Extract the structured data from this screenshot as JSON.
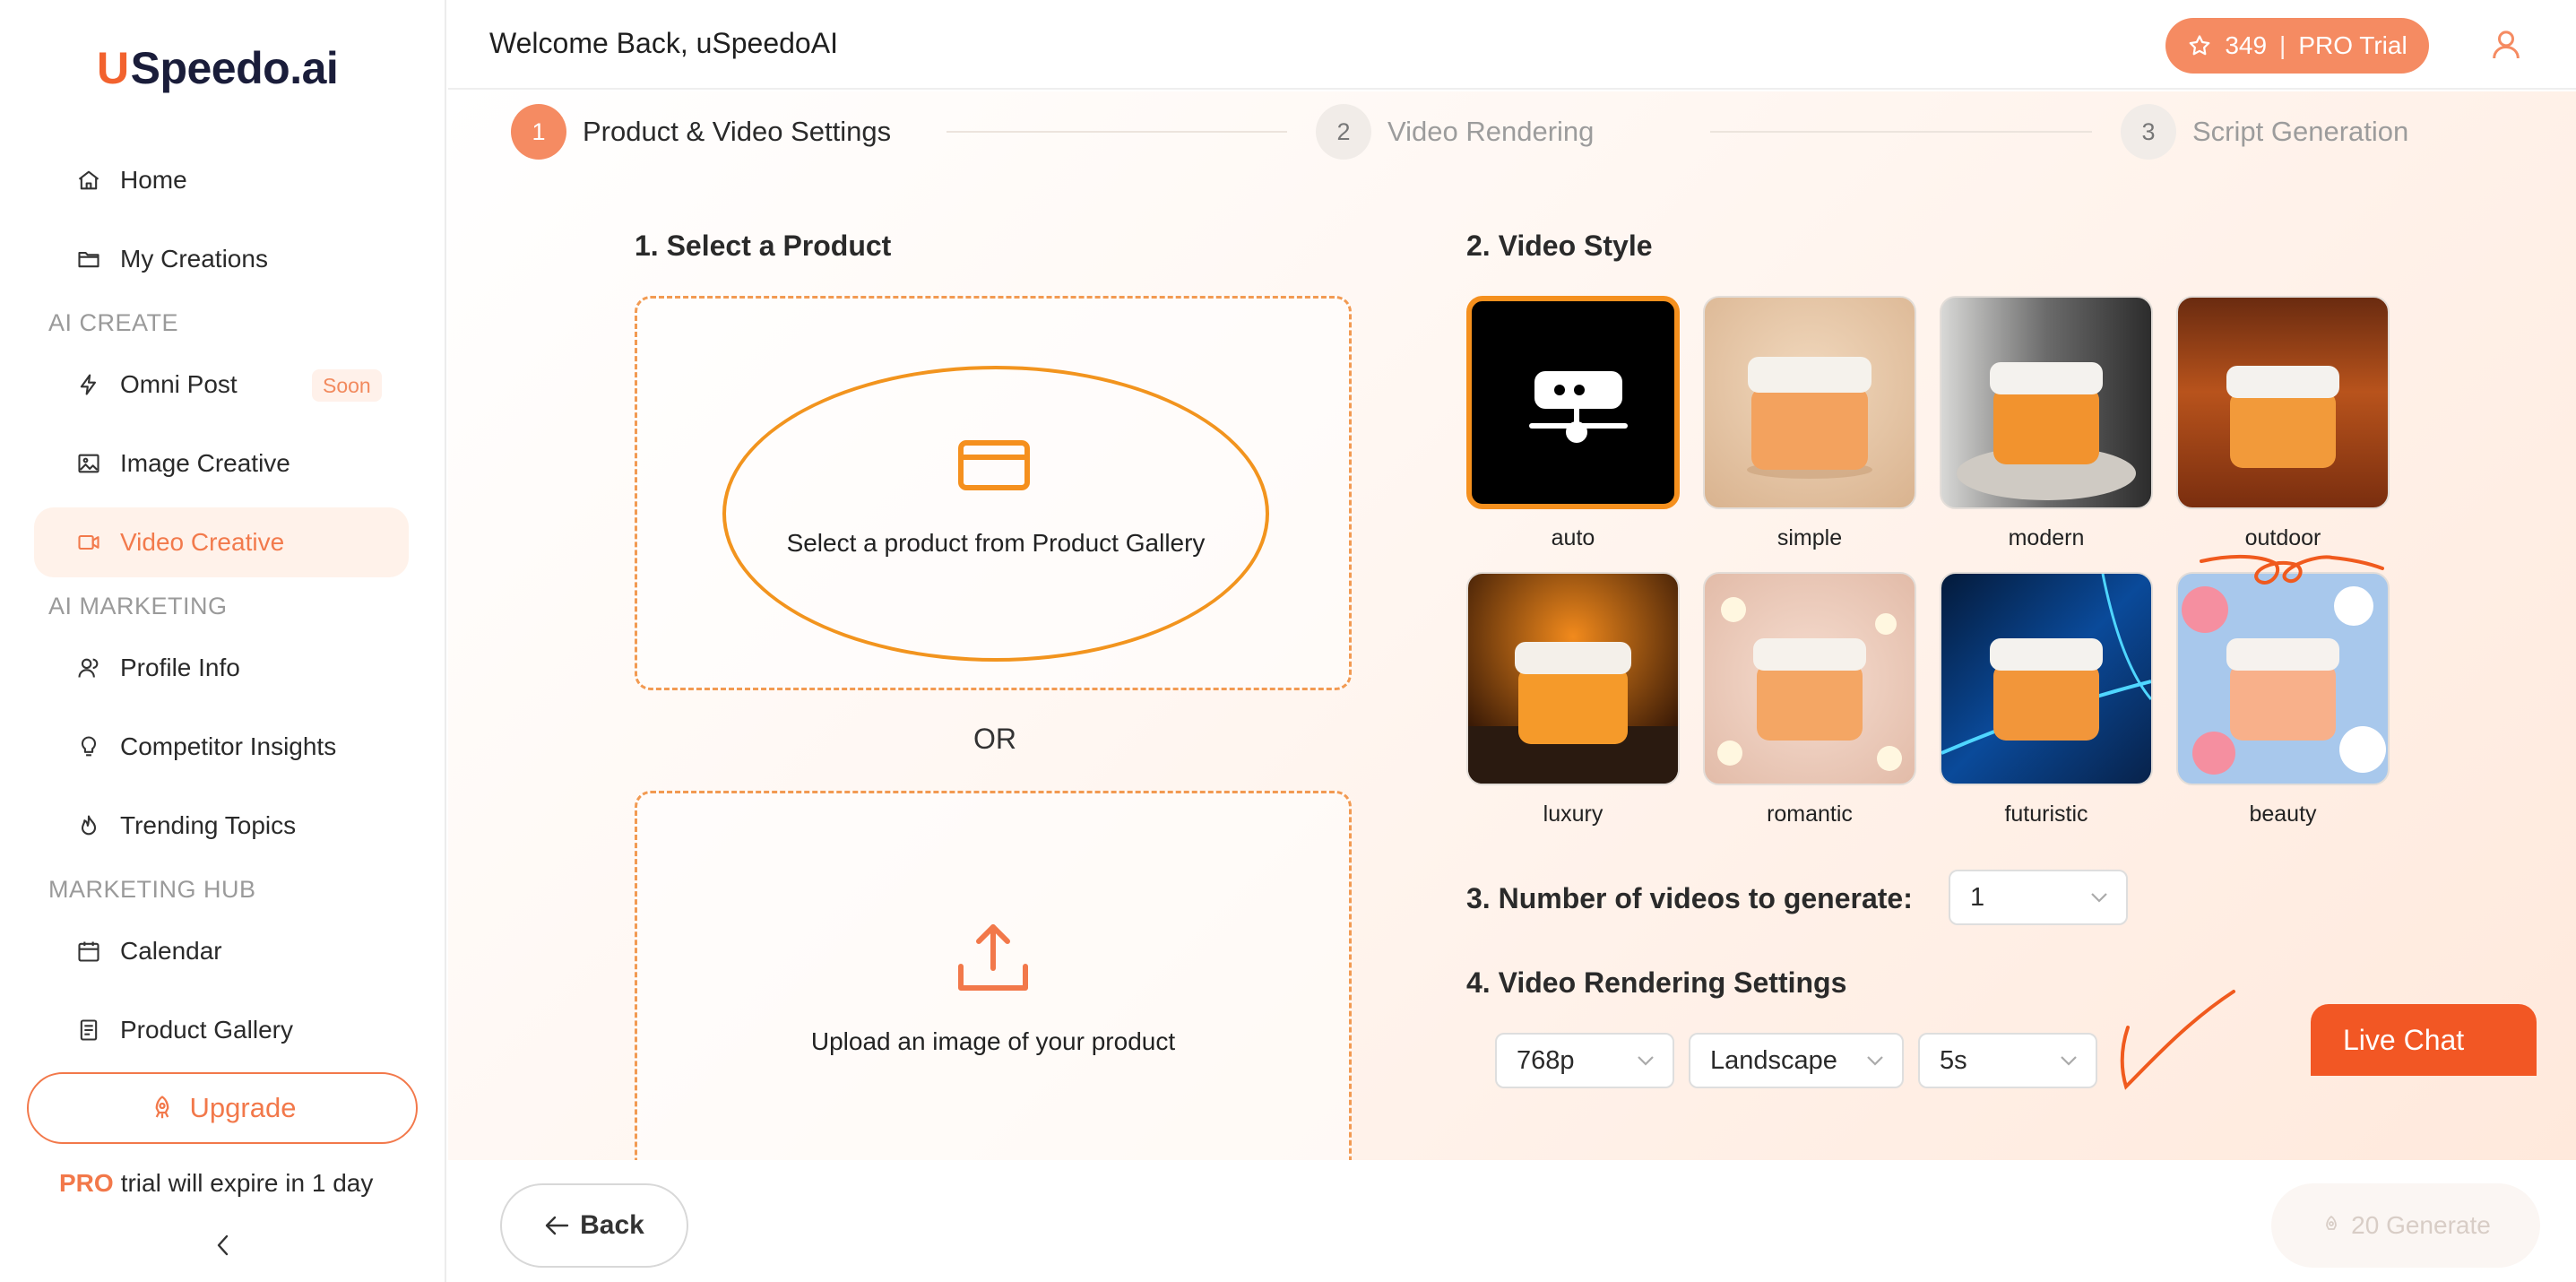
{
  "app": {
    "logo_u": "U",
    "logo_rest": "Speedo.ai"
  },
  "header": {
    "welcome": "Welcome Back, uSpeedoAI",
    "credits": "349",
    "separator": "|",
    "plan": "PRO Trial"
  },
  "sidebar": {
    "home": "Home",
    "my_creations": "My Creations",
    "section_ai_create": "AI CREATE",
    "omni_post": "Omni Post",
    "soon": "Soon",
    "image_creative": "Image Creative",
    "video_creative": "Video Creative",
    "section_ai_marketing": "AI MARKETING",
    "profile_info": "Profile Info",
    "competitor_insights": "Competitor Insights",
    "trending_topics": "Trending Topics",
    "section_marketing_hub": "MARKETING HUB",
    "calendar": "Calendar",
    "product_gallery": "Product Gallery",
    "upgrade": "Upgrade",
    "trial_pro": "PRO",
    "trial_text": "trial will expire in 1 day"
  },
  "steps": [
    {
      "num": "1",
      "label": "Product & Video Settings",
      "active": true
    },
    {
      "num": "2",
      "label": "Video Rendering",
      "active": false
    },
    {
      "num": "3",
      "label": "Script Generation",
      "active": false
    }
  ],
  "product": {
    "title": "1. Select a Product",
    "gallery_text": "Select a product from Product Gallery",
    "or": "OR",
    "upload_text": "Upload an image of your product"
  },
  "style": {
    "title": "2. Video Style",
    "options": [
      "auto",
      "simple",
      "modern",
      "outdoor",
      "luxury",
      "romantic",
      "futuristic",
      "beauty"
    ],
    "selected": "auto"
  },
  "count": {
    "label": "3. Number of videos to generate:",
    "value": "1"
  },
  "rendering": {
    "title": "4. Video Rendering Settings",
    "resolution": "768p",
    "orientation": "Landscape",
    "duration": "5s"
  },
  "live_chat": "Live Chat",
  "footer": {
    "back": "Back",
    "generate": "20 Generate"
  },
  "colors": {
    "accent": "#f58b62",
    "accent_dark": "#f25724",
    "selection": "#f5901e"
  }
}
